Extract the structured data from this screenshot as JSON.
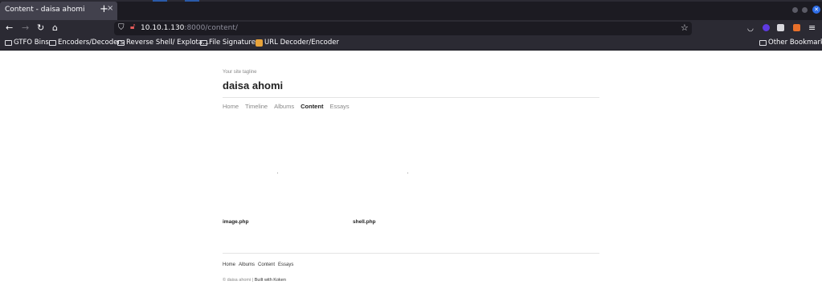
{
  "browser": {
    "tab_title": "Content - daisa ahomi",
    "tab_close": "×",
    "new_tab": "+",
    "url_host": "10.10.1.130",
    "url_rest": ":8000/content/",
    "bookmarks": [
      "GTFO Bins",
      "Encoders/Decoders",
      "Reverse Shell/ Explota...",
      "File Signatures",
      "URL Decoder/Encoder"
    ],
    "other_bookmarks": "Other Bookmarks"
  },
  "site": {
    "tagline": "Your site tagline",
    "title": "daisa ahomi",
    "nav": [
      "Home",
      "Timeline",
      "Albums",
      "Content",
      "Essays"
    ],
    "active_nav": "Content",
    "items": [
      "image.php",
      "shell.php"
    ],
    "footer_nav": [
      "Home",
      "Albums",
      "Content",
      "Essays"
    ],
    "copyright": "© daisa ahomi",
    "separator": "|",
    "built_with": "Built with Koken"
  }
}
